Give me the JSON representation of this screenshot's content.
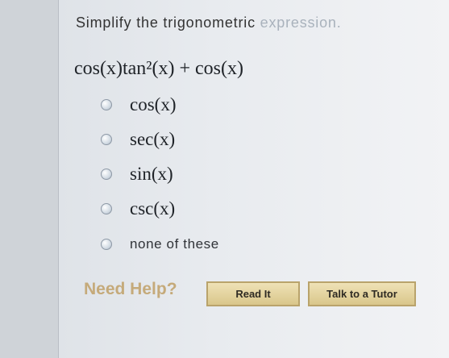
{
  "question": {
    "prompt_main": "Simplify the trigonometric",
    "prompt_faded": " expression.",
    "expression": "cos(x)tan²(x) + cos(x)"
  },
  "options": [
    {
      "label": "cos(x)"
    },
    {
      "label": "sec(x)"
    },
    {
      "label": "sin(x)"
    },
    {
      "label": "csc(x)"
    },
    {
      "label": "none of these"
    }
  ],
  "help": {
    "label": "Need Help?",
    "read_button": "Read It",
    "tutor_button": "Talk to a Tutor"
  }
}
